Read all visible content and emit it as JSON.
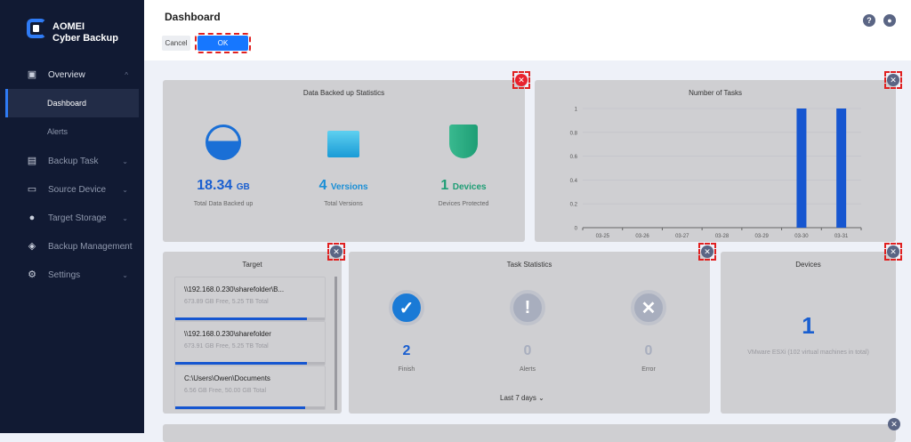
{
  "brand": {
    "line1": "AOMEI",
    "line2": "Cyber Backup"
  },
  "sidebar": {
    "items": [
      {
        "label": "Overview",
        "icon": "overview-icon"
      },
      {
        "label": "Dashboard"
      },
      {
        "label": "Alerts"
      },
      {
        "label": "Backup Task",
        "icon": "clipboard-icon"
      },
      {
        "label": "Source Device",
        "icon": "monitor-icon"
      },
      {
        "label": "Target Storage",
        "icon": "location-pin-icon"
      },
      {
        "label": "Backup Management",
        "icon": "layers-icon"
      },
      {
        "label": "Settings",
        "icon": "gear-icon"
      }
    ]
  },
  "header": {
    "title": "Dashboard",
    "cancel": "Cancel",
    "ok": "OK",
    "help": "?"
  },
  "data_stats": {
    "title": "Data Backed up Statistics",
    "total": {
      "value": "18.34",
      "unit": "GB",
      "label": "Total Data Backed up"
    },
    "versions": {
      "value": "4",
      "unit": "Versions",
      "label": "Total Versions"
    },
    "devices": {
      "value": "1",
      "unit": "Devices",
      "label": "Devices Protected"
    }
  },
  "chart_data": {
    "type": "bar",
    "title": "Number of Tasks",
    "categories": [
      "03-25",
      "03-26",
      "03-27",
      "03-28",
      "03-29",
      "03-30",
      "03-31"
    ],
    "values": [
      0,
      0,
      0,
      0,
      0,
      1,
      1
    ],
    "ylim": [
      0,
      1
    ],
    "yticks": [
      "0",
      "0.2",
      "0.4",
      "0.6",
      "0.8",
      "1"
    ],
    "color": "#1656d0",
    "grid": true
  },
  "target": {
    "title": "Target",
    "items": [
      {
        "path": "\\\\192.168.0.230\\sharefolder\\B...",
        "size": "673.89 GB Free, 5.25 TB Total",
        "used": 0.88
      },
      {
        "path": "\\\\192.168.0.230\\sharefolder",
        "size": "673.91 GB Free, 5.25 TB Total",
        "used": 0.88
      },
      {
        "path": "C:\\Users\\Owen\\Documents",
        "size": "6.56 GB Free, 50.00 GB Total",
        "used": 0.87
      }
    ]
  },
  "task_stats": {
    "title": "Task Statistics",
    "finish": {
      "value": "2",
      "label": "Finish"
    },
    "alerts": {
      "value": "0",
      "label": "Alerts"
    },
    "error": {
      "value": "0",
      "label": "Error"
    },
    "range": "Last 7 days"
  },
  "devices": {
    "title": "Devices",
    "value": "1",
    "desc": "VMware ESXi (102 virtual machines in total)"
  }
}
